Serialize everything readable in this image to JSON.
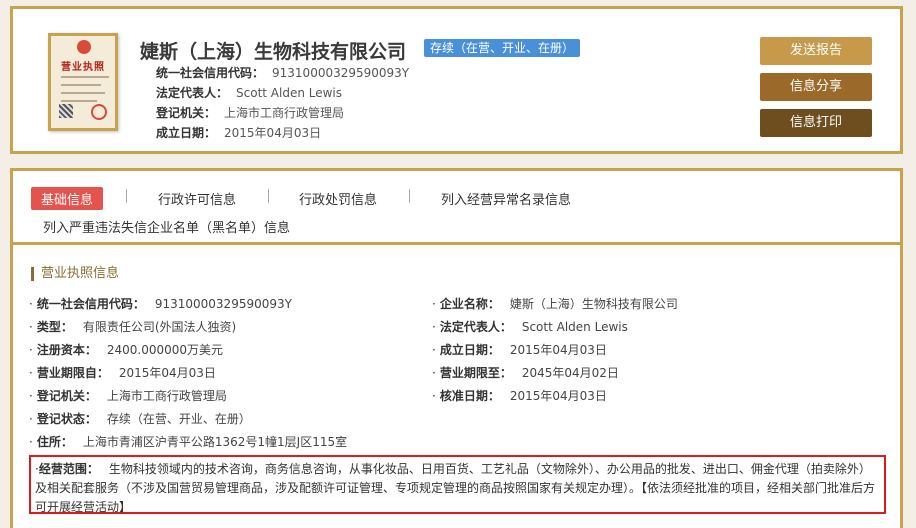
{
  "header": {
    "company_name": "婕斯（上海）生物科技有限公司",
    "status_badge": "存续（在营、开业、在册）",
    "credit_code_label": "统一社会信用代码：",
    "credit_code_value": "91310000329590093Y",
    "legal_rep_label": "法定代表人：",
    "legal_rep_value": "Scott Alden Lewis",
    "registry_label": "登记机关：",
    "registry_value": "上海市工商行政管理局",
    "established_label": "成立日期：",
    "established_value": "2015年04月03日",
    "license_icon_text": "营业执照",
    "buttons": {
      "report": "发送报告",
      "share": "信息分享",
      "print": "信息打印"
    }
  },
  "tabs": [
    {
      "label": "基础信息",
      "active": true
    },
    {
      "label": "行政许可信息"
    },
    {
      "label": "行政处罚信息"
    },
    {
      "label": "列入经营异常名录信息"
    },
    {
      "label": "列入严重违法失信企业名单（黑名单）信息"
    }
  ],
  "section": {
    "title": "营业执照信息"
  },
  "fields": {
    "credit_code": {
      "label": "统一社会信用代码：",
      "value": "91310000329590093Y"
    },
    "company_name": {
      "label": "企业名称：",
      "value": "婕斯（上海）生物科技有限公司"
    },
    "type": {
      "label": "类型：",
      "value": "有限责任公司(外国法人独资)"
    },
    "legal_rep": {
      "label": "法定代表人：",
      "value": "Scott Alden Lewis"
    },
    "capital": {
      "label": "注册资本：",
      "value": "2400.000000万美元"
    },
    "established": {
      "label": "成立日期：",
      "value": "2015年04月03日"
    },
    "term_from": {
      "label": "营业期限自：",
      "value": "2015年04月03日"
    },
    "term_to": {
      "label": "营业期限至：",
      "value": "2045年04月02日"
    },
    "registry": {
      "label": "登记机关：",
      "value": "上海市工商行政管理局"
    },
    "approved": {
      "label": "核准日期：",
      "value": "2015年04月03日"
    },
    "status": {
      "label": "登记状态：",
      "value": "存续（在营、开业、在册）"
    },
    "address": {
      "label": "住所：",
      "value": "上海市青浦区沪青平公路1362号1幢1层J区115室"
    }
  },
  "scope": {
    "label": "经营范围：",
    "value": "生物科技领域内的技术咨询，商务信息咨询，从事化妆品、日用百货、工艺礼品（文物除外）、办公用品的批发、进出口、佣金代理（拍卖除外）及相关配套服务（不涉及国营贸易管理商品，涉及配额许可证管理、专项规定管理的商品按照国家有关规定办理）。【依法须经批准的项目，经相关部门批准后方可开展经营活动】"
  },
  "colors": {
    "border_gold": "#c9a24d",
    "active_tab": "#e4534d",
    "status_badge": "#4a90d9",
    "scope_border": "#e0191b"
  }
}
